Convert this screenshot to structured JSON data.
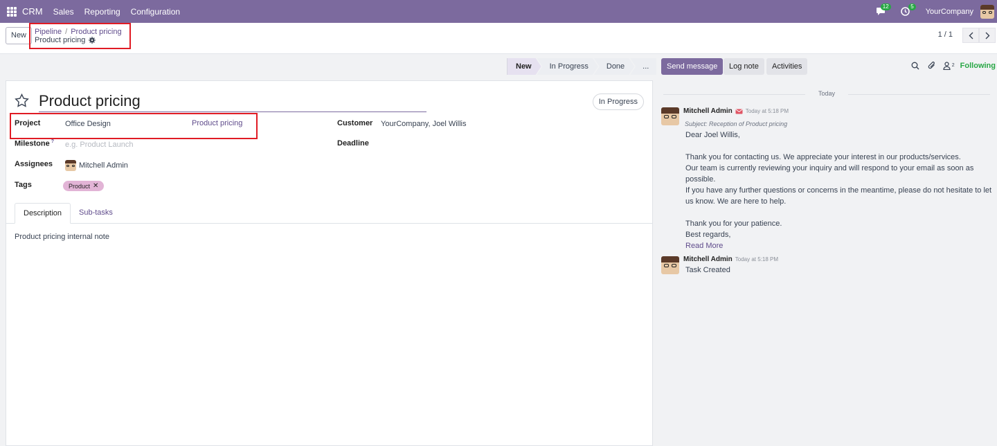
{
  "navbar": {
    "brand": "CRM",
    "menu": [
      "Sales",
      "Reporting",
      "Configuration"
    ],
    "messages_badge": "12",
    "activities_badge": "5",
    "company": "YourCompany"
  },
  "control": {
    "new_label": "New",
    "breadcrumb_parent": "Pipeline",
    "breadcrumb_sep": "/",
    "breadcrumb_item": "Product pricing",
    "current_record": "Product pricing",
    "pager": "1 / 1"
  },
  "statusbar": {
    "stages": [
      "New",
      "In Progress",
      "Done",
      "..."
    ],
    "active": "New"
  },
  "form": {
    "title": "Product pricing",
    "state": "In Progress",
    "project_label": "Project",
    "project_value": "Office Design",
    "project_extra": "Product pricing",
    "milestone_label": "Milestone",
    "milestone_help": "?",
    "milestone_placeholder": "e.g. Product Launch",
    "assignees_label": "Assignees",
    "assignee": "Mitchell Admin",
    "tags_label": "Tags",
    "tag": "Product",
    "customer_label": "Customer",
    "customer_value": "YourCompany, Joel Willis",
    "deadline_label": "Deadline",
    "tabs": [
      "Description",
      "Sub-tasks"
    ],
    "description": "Product pricing internal note"
  },
  "chatter": {
    "send_message": "Send message",
    "log_note": "Log note",
    "activities": "Activities",
    "followers_count": "2",
    "following": "Following",
    "date_separator": "Today",
    "messages": [
      {
        "author": "Mitchell Admin",
        "date": "Today at 5:18 PM",
        "subject": "Subject: Reception of Product pricing",
        "lines": [
          "Dear Joel Willis,",
          "",
          "Thank you for contacting us. We appreciate your interest in our products/services.",
          "Our team is currently reviewing your inquiry and will respond to your email as soon as possible.",
          "If you have any further questions or concerns in the meantime, please do not hesitate to let us know. We are here to help.",
          "",
          "Thank you for your patience.",
          "Best regards,"
        ],
        "read_more": "Read More"
      },
      {
        "author": "Mitchell Admin",
        "date": "Today at 5:18 PM",
        "body": "Task Created"
      }
    ]
  },
  "colors": {
    "navbar": "#7c6a9e",
    "link": "#5f4b8b",
    "highlight": "#e01b24",
    "following": "#28a745"
  }
}
